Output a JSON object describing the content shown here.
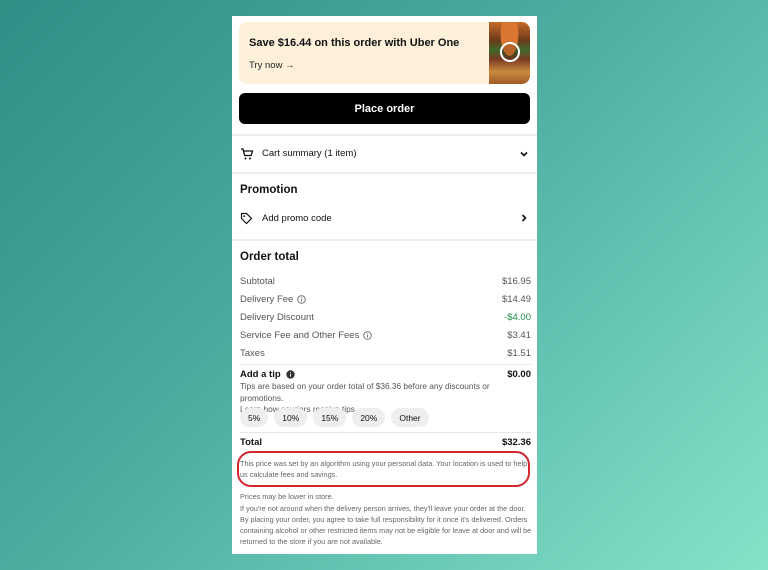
{
  "uber_one": {
    "title": "Save $16.44 on this order with Uber One",
    "cta": "Try now →"
  },
  "place_order_label": "Place order",
  "cart": {
    "summary_label": "Cart summary (1 item)"
  },
  "promotion": {
    "heading": "Promotion",
    "add_promo_label": "Add promo code"
  },
  "order_total": {
    "heading": "Order total",
    "rows": [
      {
        "label": "Subtotal",
        "value": "$16.95"
      },
      {
        "label": "Delivery Fee",
        "value": "$14.49"
      },
      {
        "label": "Delivery Discount",
        "value": "-$4.00"
      },
      {
        "label": "Service Fee and Other Fees",
        "value": "$3.41"
      },
      {
        "label": "Taxes",
        "value": "$1.51"
      }
    ]
  },
  "tip": {
    "label": "Add a tip",
    "value": "$0.00",
    "note_line1": "Tips are based on your order total of $36.36 before any discounts or promotions.",
    "note_line2": "Learn how couriers receive tips.",
    "options": [
      "5%",
      "10%",
      "15%",
      "20%",
      "Other"
    ]
  },
  "total": {
    "label": "Total",
    "value": "$32.36"
  },
  "algorithm_note": "This price was set by an algorithm using your personal data. Your location is used to help us calculate fees and savings.",
  "store_note": "Prices may be lower in store.",
  "delivery_note": "If you're not around when the delivery person arrives, they'll leave your order at the door. By placing your order, you agree to take full responsibility for it once it's delivered. Orders containing alcohol or other restricted items may not be eligible for leave at door and will be returned to the store if you are not available.",
  "colors": {
    "discount": "#1e8a4a",
    "highlight_oval": "#d4262e",
    "place_order_bg": "#000000",
    "promo_banner_bg": "#fdf0da"
  },
  "icons": [
    "cart-icon",
    "chevron-down-icon",
    "tag-icon",
    "chevron-right-icon",
    "info-icon"
  ]
}
